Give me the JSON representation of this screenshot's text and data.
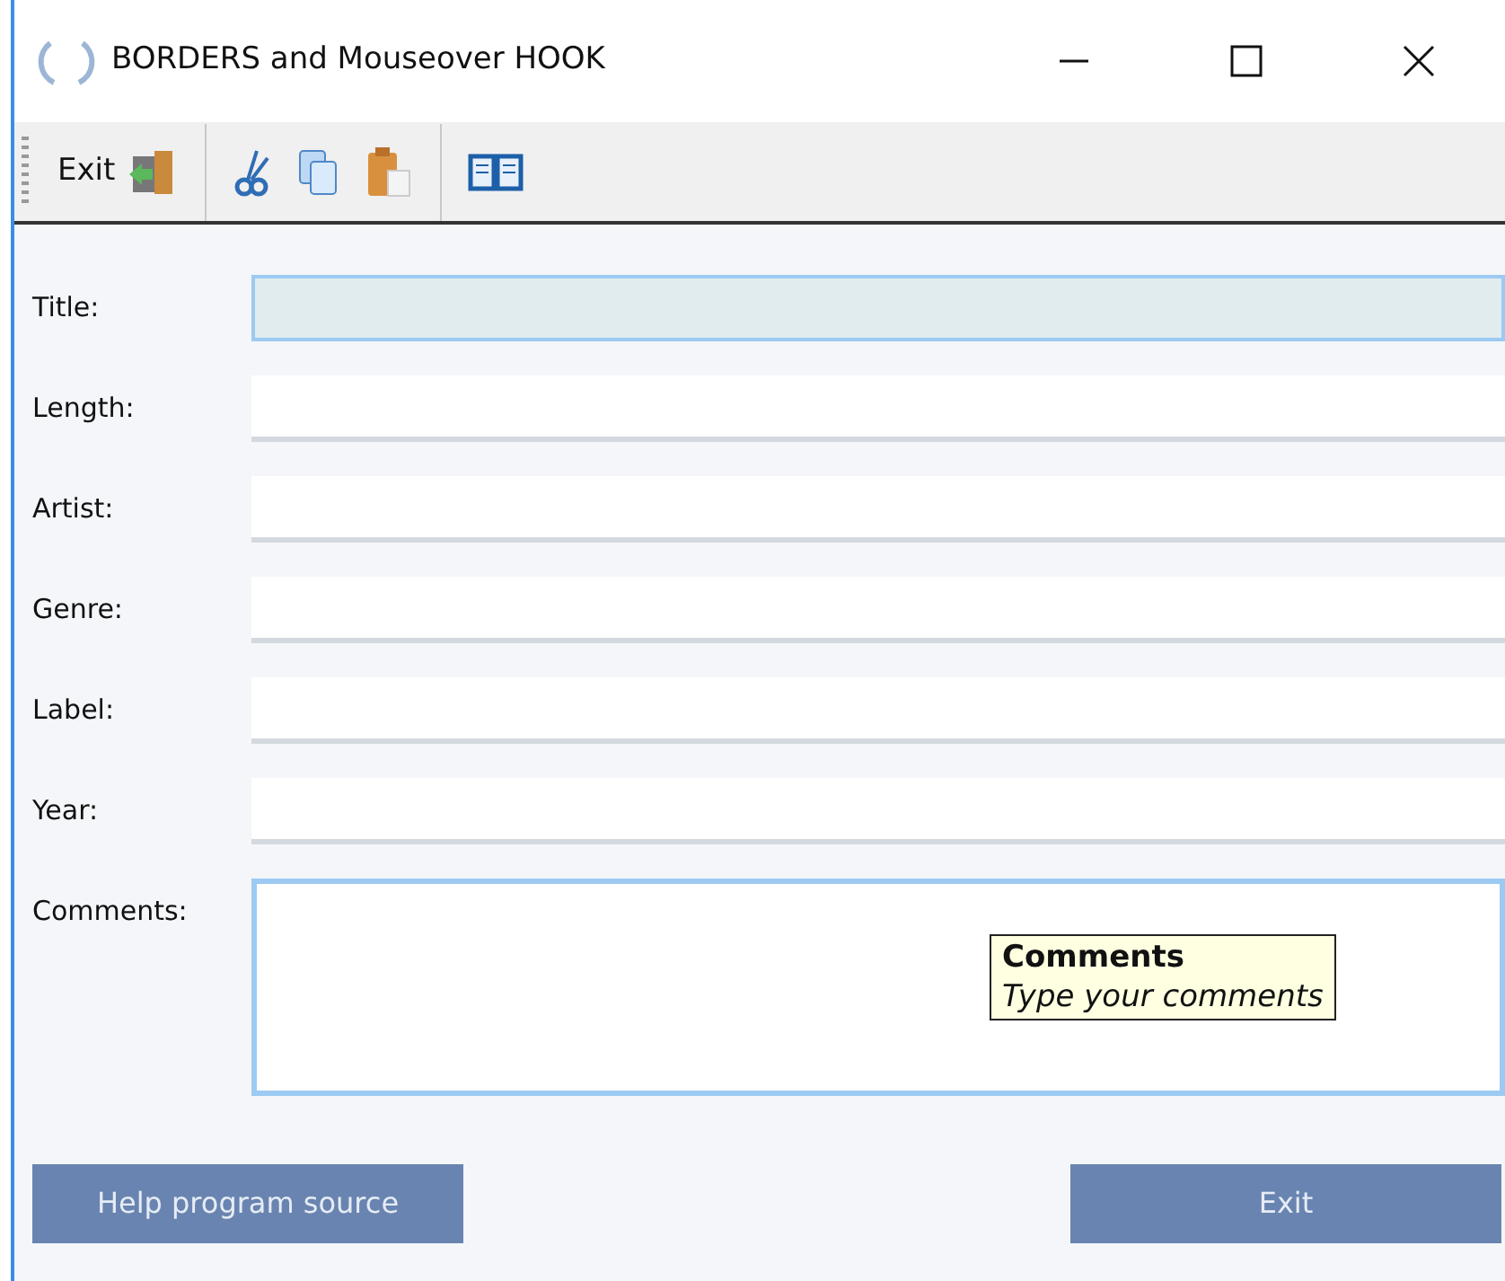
{
  "window": {
    "title": "BORDERS and Mouseover HOOK"
  },
  "toolbar": [
    {
      "kind": "exit",
      "label": "Exit"
    },
    {
      "kind": "separator"
    },
    {
      "kind": "cut"
    },
    {
      "kind": "copy"
    },
    {
      "kind": "paste"
    },
    {
      "kind": "separator"
    },
    {
      "kind": "book"
    }
  ],
  "fields": [
    {
      "label": "Title:",
      "kind": "line",
      "highlighted": true
    },
    {
      "label": "Length:",
      "kind": "line",
      "highlighted": false
    },
    {
      "label": "Artist:",
      "kind": "line",
      "highlighted": false
    },
    {
      "label": "Genre:",
      "kind": "line",
      "highlighted": false
    },
    {
      "label": "Label:",
      "kind": "line",
      "highlighted": false
    },
    {
      "label": "Year:",
      "kind": "line",
      "highlighted": false
    },
    {
      "label": "Comments:",
      "kind": "multiline",
      "highlighted": false,
      "tooltip": {
        "title": "Comments",
        "text": "Type your comments"
      }
    }
  ],
  "buttons": [
    {
      "label": "Help program source"
    },
    {
      "label": "Exit"
    }
  ]
}
